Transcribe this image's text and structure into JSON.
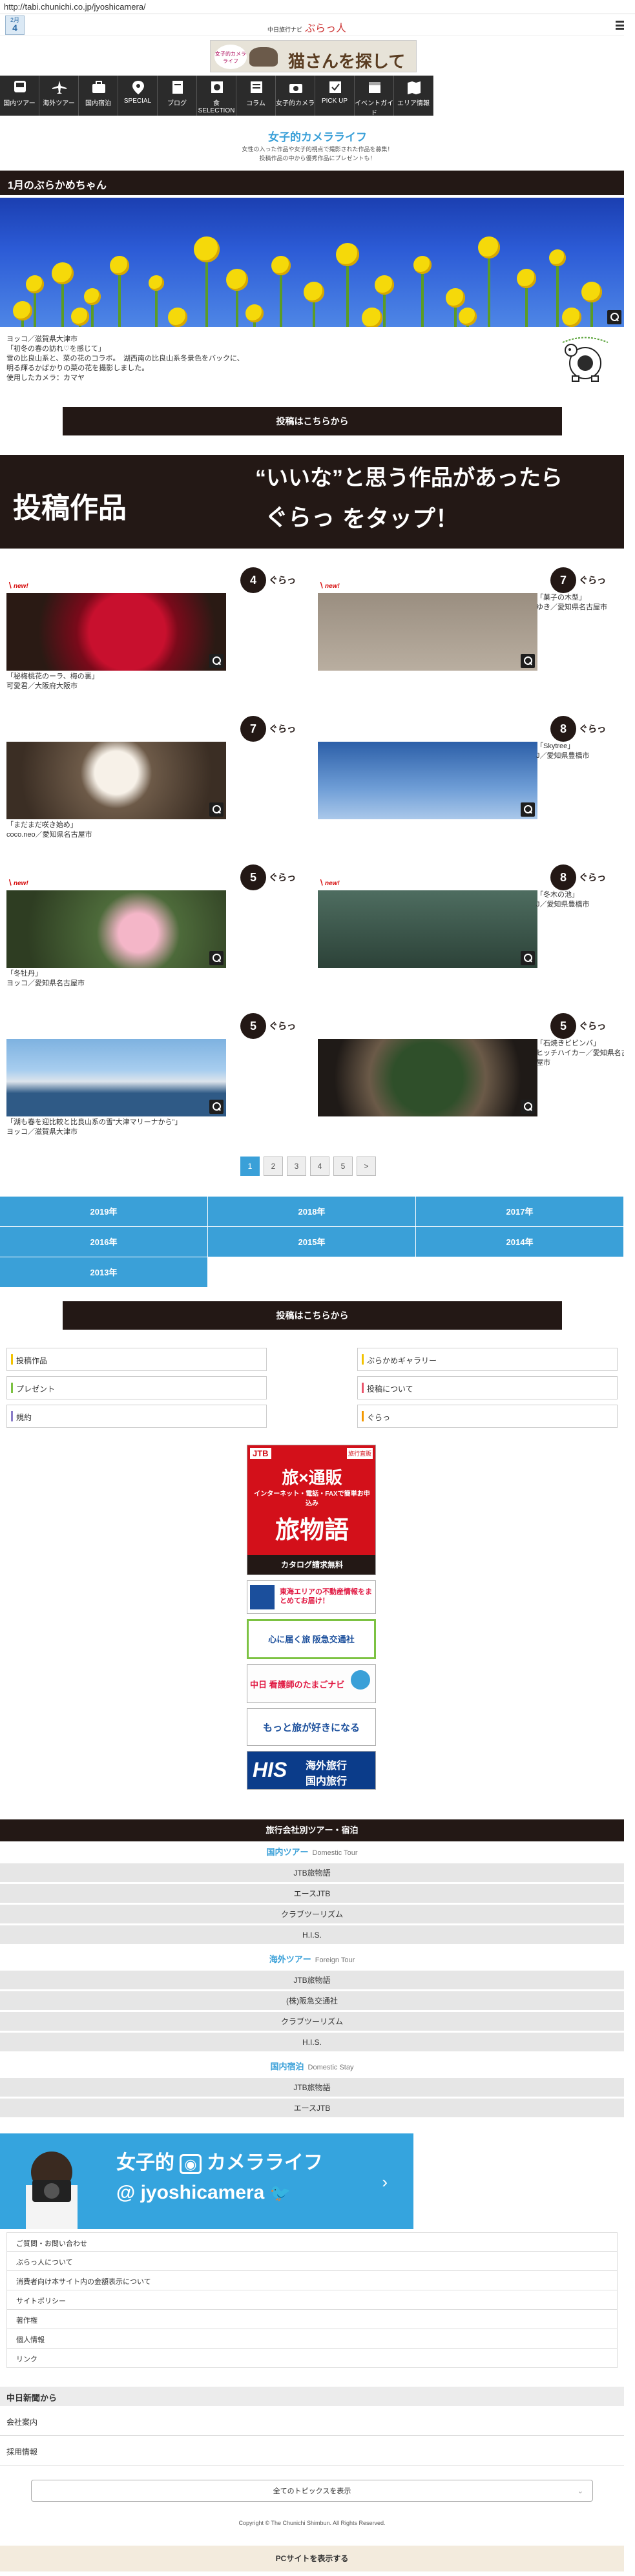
{
  "browser": {
    "url": "http://tabi.chunichi.co.jp/jyoshicamera/"
  },
  "header": {
    "date_month": "2月",
    "date_day": "4",
    "site_name": "中日旅行ナビ",
    "logo": "ぶらっ人",
    "banner_left": "女子的カメラライフ",
    "banner_main": "猫さんを探して"
  },
  "nav": [
    {
      "label": "国内ツアー",
      "icon": "bus-icon"
    },
    {
      "label": "海外ツアー",
      "icon": "airplane-icon"
    },
    {
      "label": "国内宿泊",
      "icon": "suitcase-icon"
    },
    {
      "label": "SPECIAL",
      "icon": "pin-icon"
    },
    {
      "label": "ブログ",
      "icon": "notebook-icon"
    },
    {
      "label": "食SELECTION",
      "icon": "food-icon"
    },
    {
      "label": "コラム",
      "icon": "column-icon"
    },
    {
      "label": "女子的カメラ",
      "icon": "camera-icon"
    },
    {
      "label": "PICK UP",
      "icon": "pickup-icon"
    },
    {
      "label": "イベントガイド",
      "icon": "calendar-icon"
    },
    {
      "label": "エリア情報",
      "icon": "map-icon"
    }
  ],
  "section": {
    "title": "女子的カメラライフ",
    "lead1": "女性の入った作品や女子的視点で撮影された作品を募集！",
    "lead2": "投稿作品の中から優秀作品にプレゼントも！"
  },
  "feature": {
    "heading": "1月のぶらかめちゃん",
    "caption": [
      "ヨッコ／滋賀県大津市",
      "「初冬の春の訪れ♡を感じて」",
      "雪の比良山系と、菜の花のコラボ。　湖西南の比良山系冬景色をバックに、",
      "明る輝るかばかりの菜の花を撮影しました。",
      "使用したカメラ：カマヤ"
    ]
  },
  "post_button": "投稿はこちらから",
  "promo": {
    "left": "投稿作品",
    "right_line1": "“いいな”と思う作品があったら",
    "right_logo": "ぐらっ",
    "right_line2": "をタップ！"
  },
  "posts": [
    {
      "new": "new!",
      "likes": "4",
      "title": "「秘梅桃花のーラ、梅の裏」",
      "author": "可愛君／大阪府大阪市"
    },
    {
      "new": "new!",
      "likes": "7",
      "title": "「菓子の木型」",
      "author": "ゆき／愛知県名古屋市"
    },
    {
      "new": "",
      "likes": "7",
      "title": "「まだまだ咲き始め」",
      "author": "coco.neo／愛知県名古屋市"
    },
    {
      "new": "",
      "likes": "8",
      "title": "「Skytree」",
      "author": "J／愛知県豊橋市"
    },
    {
      "new": "new!",
      "likes": "5",
      "title": "「冬牡丹」",
      "author": "ヨッコ／愛知県名古屋市"
    },
    {
      "new": "new!",
      "likes": "8",
      "title": "「冬木の池」",
      "author": "J／愛知県豊橋市"
    },
    {
      "new": "",
      "likes": "5",
      "title": "「湖も春を迎比較と比良山系の雪“大津マリーナから”」",
      "author": "ヨッコ／滋賀県大津市"
    },
    {
      "new": "",
      "likes": "5",
      "title": "「石焼きビビンバ」",
      "author": "ヒッチハイカー／愛知県名古屋市"
    }
  ],
  "pager": [
    "1",
    "2",
    "3",
    "4",
    "5",
    ">"
  ],
  "years": [
    "2019年",
    "2018年",
    "2017年",
    "2016年",
    "2015年",
    "2014年",
    "2013年"
  ],
  "links": [
    {
      "label": "投稿作品",
      "color": "#f2c200"
    },
    {
      "label": "ぶらかめギャラリー",
      "color": "#f2c200"
    },
    {
      "label": "プレゼント",
      "color": "#7cc242"
    },
    {
      "label": "投稿について",
      "color": "#e9546b"
    },
    {
      "label": "規約",
      "color": "#8a7cc8"
    },
    {
      "label": "ぐらっ",
      "color": "#f39800"
    }
  ],
  "ads": {
    "ad1_brand": "JTB",
    "ad1_tag": "旅行直販",
    "ad1_main": "旅×通販",
    "ad1_sub": "インターネット・電話・FAXで簡単お申込み",
    "ad1_name": "旅物語",
    "ad1_cta": "カタログ請求無料",
    "ad2_text": "東海エリアの不動産情報をまとめてお届け！",
    "ad3_text": "心に届く旅 阪急交通社",
    "ad4_text": "中日 看護師のたまごナビ",
    "ad5_text": "もっと旅が好きになる",
    "ad6_brand": "HIS",
    "ad6_text1": "海外旅行",
    "ad6_text2": "国内旅行"
  },
  "tours": {
    "header": "旅行会社別ツアー・宿泊",
    "domestic": {
      "title": "国内ツアー",
      "en": "Domestic Tour",
      "items": [
        "JTB旅物語",
        "エースJTB",
        "クラブツーリズム",
        "H.I.S."
      ]
    },
    "foreign": {
      "title": "海外ツアー",
      "en": "Foreign Tour",
      "items": [
        "JTB旅物語",
        "(株)阪急交通社",
        "クラブツーリズム",
        "H.I.S."
      ]
    },
    "stay": {
      "title": "国内宿泊",
      "en": "Domestic Stay",
      "items": [
        "JTB旅物語",
        "エースJTB"
      ]
    }
  },
  "instagram": {
    "line1": "女子的",
    "line1b": "カメラライフ",
    "line2": "@ jyoshicamera"
  },
  "footer_links": [
    "ご質問・お問い合わせ",
    "ぶらっ人について",
    "消費者向け本サイト内の金額表示について",
    "サイトポリシー",
    "著作権",
    "個人情報",
    "リンク"
  ],
  "chunichi": {
    "header": "中日新聞から",
    "items": [
      "会社案内",
      "採用情報"
    ]
  },
  "all_topics": "全てのトピックスを表示",
  "copyright": "Copyright © The Chunichi Shimbun. All Rights Reserved.",
  "pc_button": "PCサイトを表示する"
}
